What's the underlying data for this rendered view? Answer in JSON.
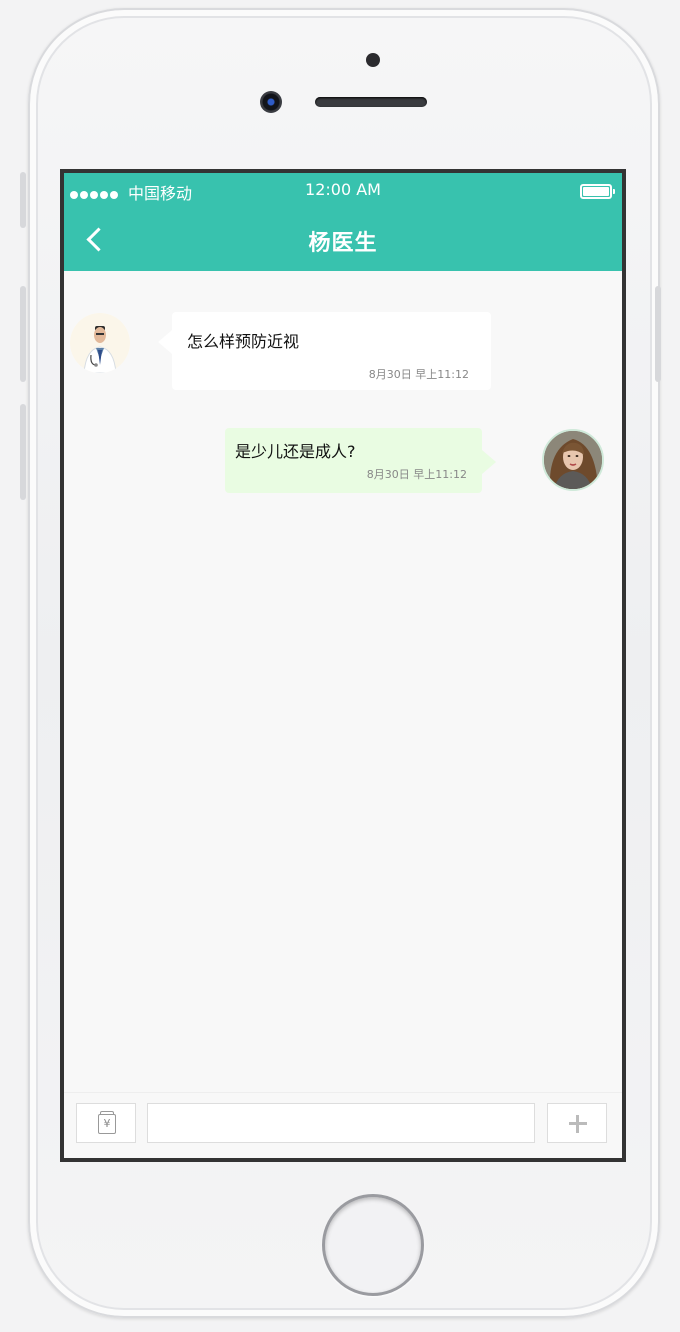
{
  "status_bar": {
    "carrier": "中国移动",
    "time": "12:00 AM"
  },
  "header": {
    "title": "杨医生",
    "color": "#38c2ae"
  },
  "messages": [
    {
      "sender": "doctor",
      "text": "怎么样预防近视",
      "time": "8月30日 早上11:12"
    },
    {
      "sender": "user",
      "text": "是少儿还是成人?",
      "time": "8月30日 早上11:12"
    }
  ],
  "input_bar": {
    "pay_icon": "yen-icon",
    "add_icon": "plus-icon",
    "placeholder": ""
  }
}
